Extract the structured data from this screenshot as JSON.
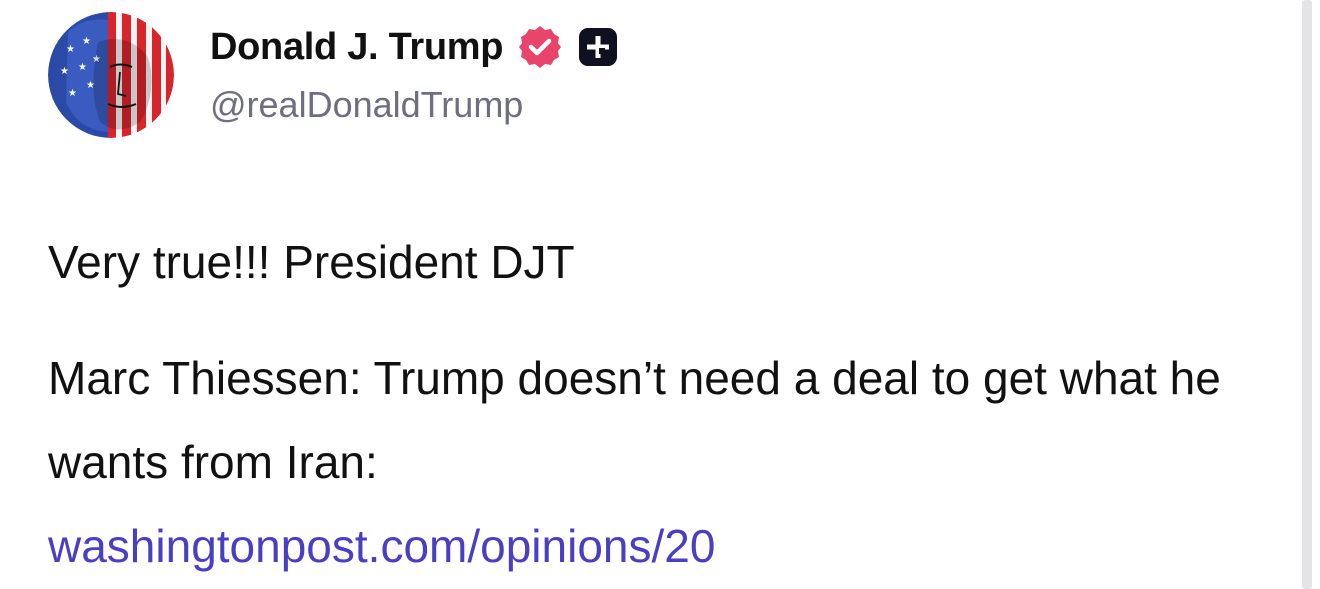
{
  "author": {
    "display_name": "Donald J. Trump",
    "handle": "@realDonaldTrump",
    "verified_icon": "verified-check-badge",
    "plus_icon": "plus-square-badge"
  },
  "post": {
    "line1": "Very true!!! President DJT",
    "quote": "Marc Thiessen: Trump doesn’t need a deal to get what he wants from Iran:",
    "link_text": "washingtonpost.com/opinions/20"
  },
  "colors": {
    "verified_badge": "#e9456a",
    "link": "#4a3fc4",
    "handle": "#6e6e80"
  }
}
